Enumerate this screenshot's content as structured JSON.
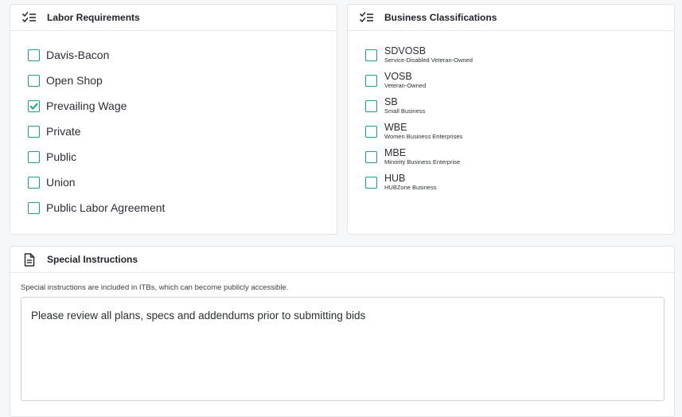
{
  "labor": {
    "title": "Labor Requirements",
    "icon": "checklist-icon",
    "options": [
      {
        "label": "Davis-Bacon",
        "checked": false
      },
      {
        "label": "Open Shop",
        "checked": false
      },
      {
        "label": "Prevailing Wage",
        "checked": true
      },
      {
        "label": "Private",
        "checked": false
      },
      {
        "label": "Public",
        "checked": false
      },
      {
        "label": "Union",
        "checked": false
      },
      {
        "label": "Public Labor Agreement",
        "checked": false
      }
    ]
  },
  "business": {
    "title": "Business Classifications",
    "icon": "checklist-icon",
    "options": [
      {
        "label": "SDVOSB",
        "sublabel": "Service-Disabled Veteran-Owned",
        "checked": false
      },
      {
        "label": "VOSB",
        "sublabel": "Veteran-Owned",
        "checked": false
      },
      {
        "label": "SB",
        "sublabel": "Small Business",
        "checked": false
      },
      {
        "label": "WBE",
        "sublabel": "Women Business Enterprises",
        "checked": false
      },
      {
        "label": "MBE",
        "sublabel": "Minority Business Enterprise",
        "checked": false
      },
      {
        "label": "HUB",
        "sublabel": "HUBZone Business",
        "checked": false
      }
    ]
  },
  "special": {
    "title": "Special Instructions",
    "icon": "document-icon",
    "note": "Special instructions are included in ITBs, which can become publicly accessible.",
    "value": "Please review all plans, specs and addendums prior to submitting bids"
  },
  "colors": {
    "accent": "#1a9e86"
  }
}
